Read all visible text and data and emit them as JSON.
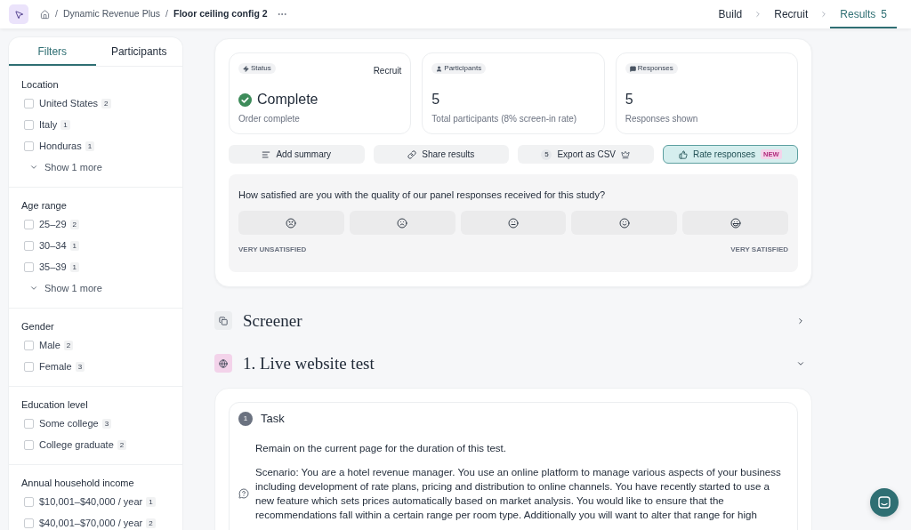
{
  "topbar": {
    "breadcrumbs": [
      {
        "separator": "/",
        "label": "Dynamic Revenue Plus",
        "current": false
      },
      {
        "separator": "/",
        "label": "Floor ceiling config 2",
        "current": true
      }
    ],
    "steps": [
      {
        "label": "Build",
        "selected": false
      },
      {
        "label": "Recruit",
        "selected": false
      },
      {
        "label": "Results",
        "count": "5",
        "selected": true
      }
    ]
  },
  "sidebar": {
    "tabs": [
      {
        "label": "Filters",
        "selected": true
      },
      {
        "label": "Participants",
        "selected": false
      }
    ],
    "sections": [
      {
        "title": "Location",
        "options": [
          {
            "label": "United States",
            "count": "2",
            "checked": false
          },
          {
            "label": "Italy",
            "count": "1",
            "checked": false
          },
          {
            "label": "Honduras",
            "count": "1",
            "checked": false
          }
        ],
        "more": "Show 1 more"
      },
      {
        "title": "Age range",
        "options": [
          {
            "label": "25–29",
            "count": "2",
            "checked": false
          },
          {
            "label": "30–34",
            "count": "1",
            "checked": false
          },
          {
            "label": "35–39",
            "count": "1",
            "checked": false
          }
        ],
        "more": "Show 1 more"
      },
      {
        "title": "Gender",
        "options": [
          {
            "label": "Male",
            "count": "2",
            "checked": false
          },
          {
            "label": "Female",
            "count": "3",
            "checked": false
          }
        ]
      },
      {
        "title": "Education level",
        "options": [
          {
            "label": "Some college",
            "count": "3",
            "checked": false
          },
          {
            "label": "College graduate",
            "count": "2",
            "checked": false
          }
        ]
      },
      {
        "title": "Annual household income",
        "options": [
          {
            "label": "$10,001–$40,000 / year",
            "count": "1",
            "checked": false
          },
          {
            "label": "$40,001–$70,000 / year",
            "count": "2",
            "checked": false
          }
        ]
      }
    ]
  },
  "summary": {
    "stats": [
      {
        "kind": "status",
        "tag": "Status",
        "action": "Recruit",
        "value": "Complete",
        "caption": "Order complete"
      },
      {
        "kind": "participants",
        "tag": "Participants",
        "value": "5",
        "caption": "Total participants (8% screen-in rate)"
      },
      {
        "kind": "responses",
        "tag": "Responses",
        "value": "5",
        "caption": "Responses shown"
      }
    ],
    "actions": [
      {
        "kind": "summary",
        "label": "Add summary"
      },
      {
        "kind": "share",
        "label": "Share results"
      },
      {
        "kind": "export",
        "count": "5",
        "label": "Export as CSV"
      },
      {
        "kind": "rate",
        "label": "Rate responses",
        "badge": "NEW"
      }
    ],
    "rating": {
      "question": "How satisfied are you with the quality of our panel responses received for this study?",
      "options": [
        {
          "kind": "very_unsatisfied",
          "selected": false
        },
        {
          "kind": "unsatisfied",
          "selected": false
        },
        {
          "kind": "neutral",
          "selected": false
        },
        {
          "kind": "satisfied",
          "selected": false
        },
        {
          "kind": "very_satisfied",
          "selected": false
        }
      ],
      "low_label": "VERY UNSATISFIED",
      "high_label": "VERY SATISFIED"
    }
  },
  "sections": [
    {
      "kind": "screener",
      "title": "Screener",
      "expanded": false
    },
    {
      "kind": "website",
      "title": "1. Live website test",
      "expanded": true
    }
  ],
  "task": {
    "number": "1",
    "title": "Task",
    "paragraphs": [
      "Remain on the current page for the duration of this test.",
      "Scenario: You are a hotel revenue manager. You use an online platform to manage various aspects of your business including development of rate plans, pricing and distribution to online channels. You have recently started to use a new feature which sets prices automatically based on market analysis. You would like to ensure that the recommendations fall within a certain range per room type. Additionally you will want to alter that range for high"
    ]
  }
}
